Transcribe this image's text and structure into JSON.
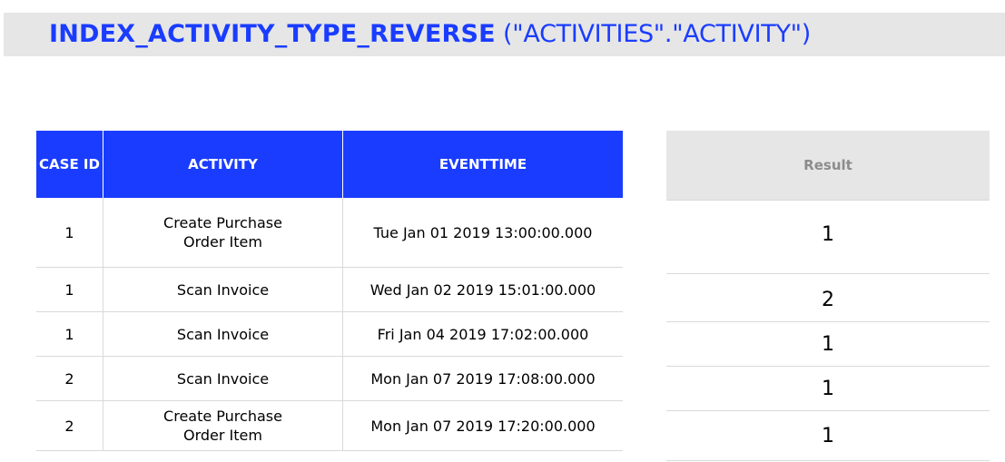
{
  "title": {
    "function_name": "INDEX_ACTIVITY_TYPE_REVERSE",
    "arguments": " (\"ACTIVITIES\".\"ACTIVITY\")"
  },
  "input_table": {
    "headers": {
      "case_id": "CASE ID",
      "activity": "ACTIVITY",
      "eventtime": "EVENTTIME"
    },
    "rows": [
      {
        "case_id": "1",
        "activity": "Create Purchase Order Item",
        "eventtime": "Tue Jan 01 2019 13:00:00.000"
      },
      {
        "case_id": "1",
        "activity": "Scan Invoice",
        "eventtime": "Wed Jan 02 2019 15:01:00.000"
      },
      {
        "case_id": "1",
        "activity": "Scan Invoice",
        "eventtime": "Fri Jan 04 2019 17:02:00.000"
      },
      {
        "case_id": "2",
        "activity": "Scan Invoice",
        "eventtime": "Mon Jan 07 2019 17:08:00.000"
      },
      {
        "case_id": "2",
        "activity": "Create Purchase Order Item",
        "eventtime": "Mon Jan 07 2019 17:20:00.000"
      }
    ]
  },
  "result_table": {
    "header": "Result",
    "values": [
      "1",
      "2",
      "1",
      "1",
      "1"
    ]
  },
  "colors": {
    "accent": "#1a3cff",
    "header_gray": "#e6e6e6",
    "border": "#d9d9d9"
  }
}
